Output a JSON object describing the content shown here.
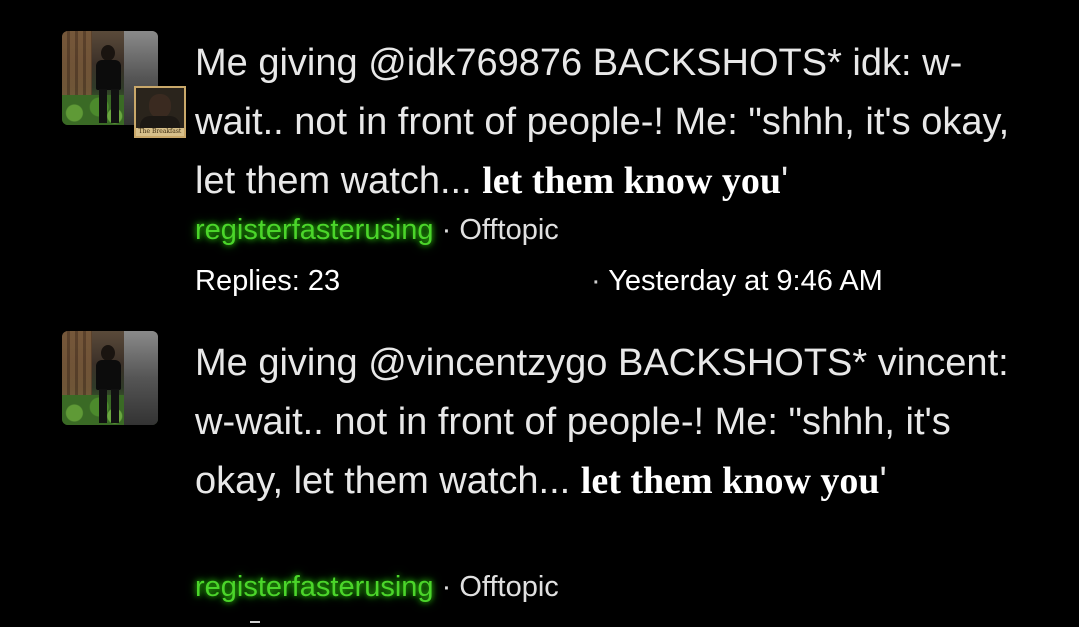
{
  "threads": [
    {
      "title_plain": "Me giving @idk769876 BACKSHOTS* idk: w-wait.. not in front of people-! Me: \"shhh, it's okay, let them watch... ",
      "title_styled": "let them know you",
      "title_tail": "'",
      "author": "registerfasterusing",
      "separator": "·",
      "forum": "Offtopic",
      "replies": "Replies: 23",
      "date_separator": "·",
      "date": "Yesterday at 9:46 AM",
      "avatar_icon": "user-photo-avatar",
      "secondary_avatar_icon": "user-mini-avatar",
      "secondary_avatar_caption": "The Breakfast"
    },
    {
      "title_plain": "Me giving @vincentzygo BACKSHOTS* vincent: w-wait.. not in front of people-! Me: \"shhh, it's okay, let them watch... ",
      "title_styled": "let them know you",
      "title_tail": "'",
      "author": "registerfasterusing",
      "separator": "·",
      "forum": "Offtopic",
      "avatar_icon": "user-photo-avatar"
    }
  ],
  "colors": {
    "background": "#000000",
    "author_accent": "#4bd52a",
    "text": "#e8e8e8"
  }
}
